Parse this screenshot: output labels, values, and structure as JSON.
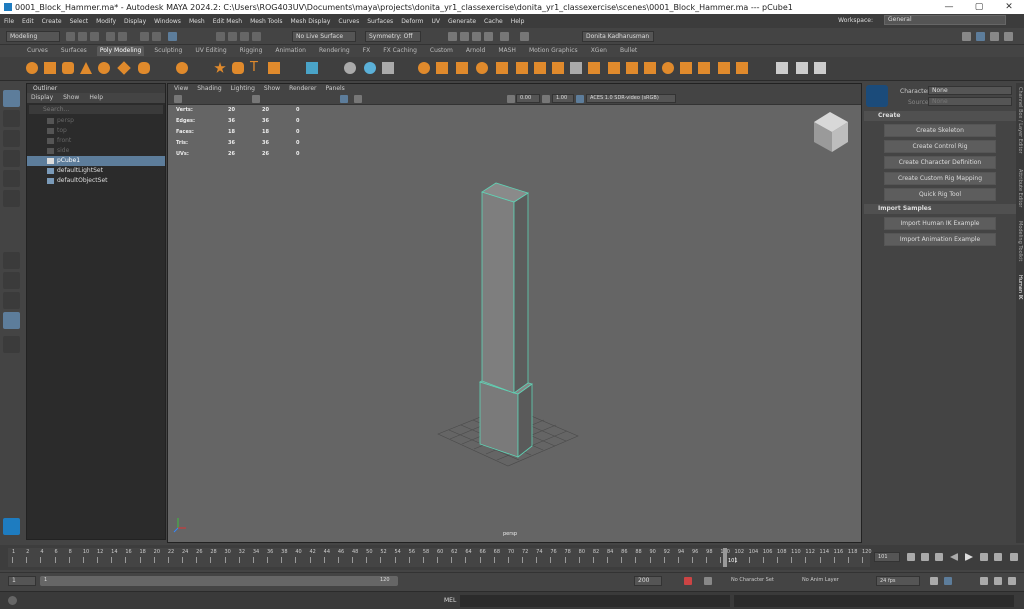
{
  "window": {
    "title": "0001_Block_Hammer.ma* - Autodesk MAYA 2024.2: C:\\Users\\ROG403UV\\Documents\\maya\\projects\\donita_yr1_classexercise\\donita_yr1_classexercise\\scenes\\0001_Block_Hammer.ma --- pCube1",
    "controls": [
      "—",
      "▢",
      "✕"
    ]
  },
  "menubar": [
    "File",
    "Edit",
    "Create",
    "Select",
    "Modify",
    "Display",
    "Windows",
    "Mesh",
    "Edit Mesh",
    "Mesh Tools",
    "Mesh Display",
    "Curves",
    "Surfaces",
    "Deform",
    "UV",
    "Generate",
    "Cache",
    "Help"
  ],
  "workspace": {
    "label": "Workspace:",
    "value": "General"
  },
  "statusline": {
    "mode": "Modeling",
    "live_surface": "No Live Surface",
    "symmetry": "Symmetry: Off",
    "user": "Donita Kadharusman"
  },
  "shelf_tabs": [
    "Curves",
    "Surfaces",
    "Poly Modeling",
    "Sculpting",
    "UV Editing",
    "Rigging",
    "Animation",
    "Rendering",
    "FX",
    "FX Caching",
    "Custom",
    "Arnold",
    "MASH",
    "Motion Graphics",
    "XGen",
    "Bullet"
  ],
  "shelf_active": "Poly Modeling",
  "outliner": {
    "title": "Outliner",
    "menu": [
      "Display",
      "Show",
      "Help"
    ],
    "search_placeholder": "Search...",
    "items": [
      {
        "label": "persp",
        "state": "dim"
      },
      {
        "label": "top",
        "state": "dim"
      },
      {
        "label": "front",
        "state": "dim"
      },
      {
        "label": "side",
        "state": "dim"
      },
      {
        "label": "pCube1",
        "state": "sel"
      },
      {
        "label": "defaultLightSet",
        "state": "normal"
      },
      {
        "label": "defaultObjectSet",
        "state": "normal"
      }
    ]
  },
  "viewport": {
    "menu": [
      "View",
      "Shading",
      "Lighting",
      "Show",
      "Renderer",
      "Panels"
    ],
    "exposure": "0.00",
    "gamma": "1.00",
    "colorspace": "ACES 1.0 SDR-video (sRGB)",
    "camera_label": "persp",
    "hud": [
      {
        "label": "Verts:",
        "values": [
          "20",
          "20",
          "0"
        ]
      },
      {
        "label": "Edges:",
        "values": [
          "36",
          "36",
          "0"
        ]
      },
      {
        "label": "Faces:",
        "values": [
          "18",
          "18",
          "0"
        ]
      },
      {
        "label": "Tris:",
        "values": [
          "36",
          "36",
          "0"
        ]
      },
      {
        "label": "UVs:",
        "values": [
          "26",
          "26",
          "0"
        ]
      }
    ]
  },
  "human_ik": {
    "character_label": "Character:",
    "character_value": "None",
    "source_label": "Source:",
    "source_value": "None",
    "create_header": "Create",
    "create_buttons": [
      "Create Skeleton",
      "Create Control Rig",
      "Create Character Definition",
      "Create Custom Rig Mapping",
      "Quick Rig Tool"
    ],
    "import_header": "Import Samples",
    "import_buttons": [
      "Import Human IK Example",
      "Import Animation Example"
    ]
  },
  "side_tabs": [
    "Channel Box / Layer Editor",
    "Attribute Editor",
    "Modeling Toolkit",
    "Human IK"
  ],
  "timeline": {
    "ticks": [
      "1",
      "2",
      "4",
      "6",
      "8",
      "10",
      "12",
      "14",
      "16",
      "18",
      "20",
      "22",
      "24",
      "26",
      "28",
      "30",
      "32",
      "34",
      "36",
      "38",
      "40",
      "42",
      "44",
      "46",
      "48",
      "50",
      "52",
      "54",
      "56",
      "58",
      "60",
      "62",
      "64",
      "66",
      "68",
      "70",
      "72",
      "74",
      "76",
      "78",
      "80",
      "82",
      "84",
      "86",
      "88",
      "90",
      "92",
      "94",
      "96",
      "98",
      "100",
      "102",
      "104",
      "106",
      "108",
      "110",
      "112",
      "114",
      "116",
      "118",
      "120"
    ],
    "current_frame": "101",
    "current_frame_field": "101"
  },
  "range": {
    "start": "1",
    "inner_start": "1",
    "inner_end": "120",
    "end": "200",
    "character_set": "No Character Set",
    "anim_layer": "No Anim Layer",
    "fps": "24 fps"
  },
  "cmdline": {
    "label": "MEL"
  },
  "colors": {
    "selection": "#5d7d9b",
    "shelf_orange": "#e08a2c",
    "wire": "#5fd3b5"
  }
}
